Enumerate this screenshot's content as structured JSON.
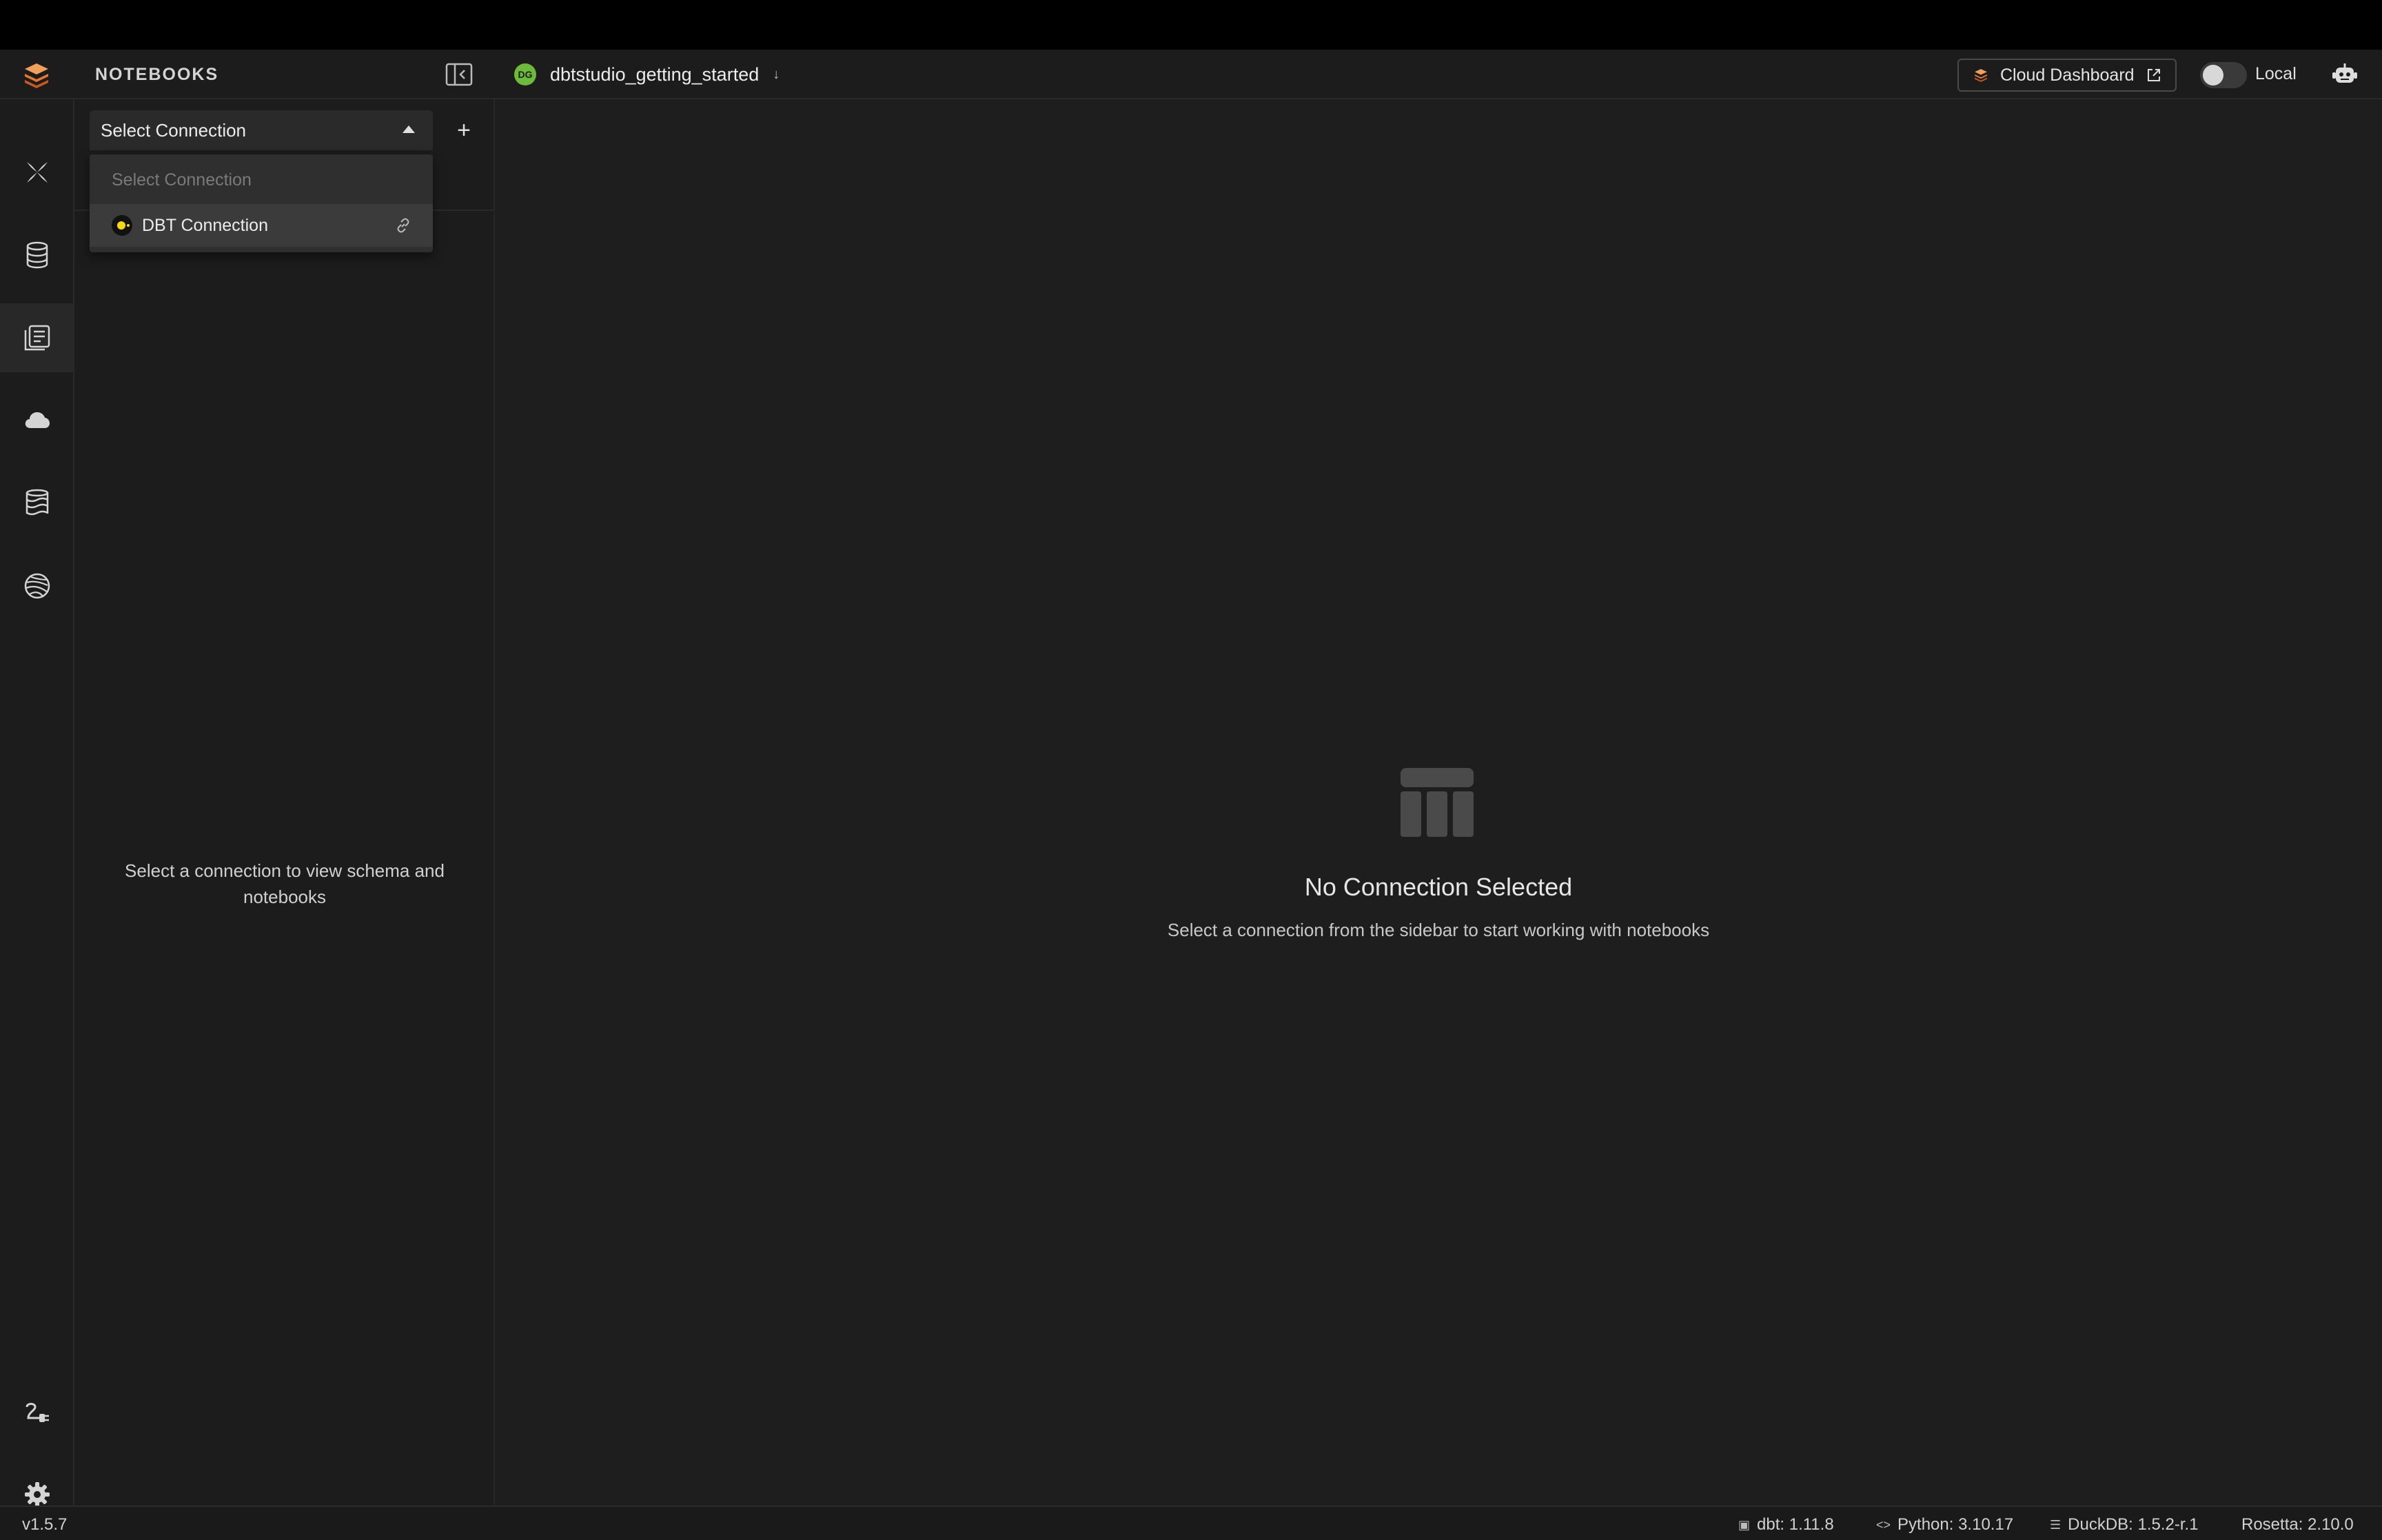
{
  "header": {
    "section_title": "NOTEBOOKS",
    "project": {
      "initials": "DG",
      "name": "dbtstudio_getting_started",
      "chevron": "↓"
    },
    "cloud_dashboard_label": "Cloud Dashboard",
    "mode_label": "Local"
  },
  "rail": {
    "items": [
      {
        "name": "modeling-icon",
        "active": false
      },
      {
        "name": "database-icon",
        "active": false
      },
      {
        "name": "notebooks-icon",
        "active": true
      },
      {
        "name": "cloud-icon",
        "active": false
      },
      {
        "name": "data-lake-icon",
        "active": false
      },
      {
        "name": "globe-icon",
        "active": false
      }
    ],
    "bottom": [
      {
        "name": "plugins-icon"
      },
      {
        "name": "settings-icon"
      }
    ]
  },
  "sidebar": {
    "select": {
      "value": "Select Connection",
      "add_label": "+"
    },
    "dropdown": {
      "placeholder": "Select Connection",
      "options": [
        {
          "label": "DBT Connection"
        }
      ]
    },
    "empty_text": "Select a connection to view schema and notebooks"
  },
  "main": {
    "empty_title": "No Connection Selected",
    "empty_subtitle": "Select a connection from the sidebar to start working with notebooks"
  },
  "statusbar": {
    "version": "v1.5.7",
    "dbt": "dbt: 1.11.8",
    "python": "Python: 3.10.17",
    "duckdb": "DuckDB: 1.5.2-r.1",
    "rosetta": "Rosetta: 2.10.0"
  },
  "colors": {
    "accent_orange": "#e8772e",
    "project_green": "#6dbb3a",
    "connection_yellow": "#f5d90a",
    "background": "#1e1e1e"
  }
}
